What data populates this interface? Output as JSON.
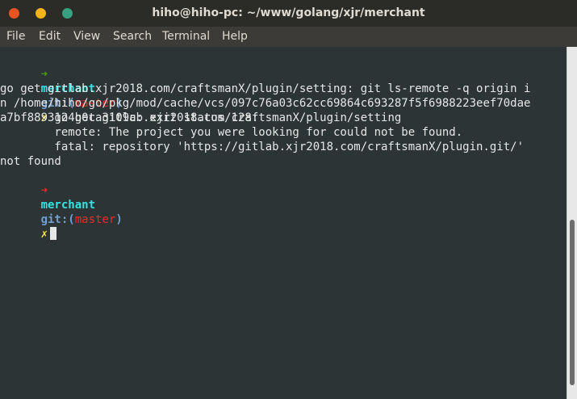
{
  "window": {
    "title": "hiho@hiho-pc: ~/www/golang/xjr/merchant"
  },
  "controls": {
    "close_color": "#e95420",
    "minimize_color": "#f5b31a",
    "maximize_color": "#37a07e"
  },
  "menu": {
    "items": [
      {
        "label": "File"
      },
      {
        "label": "Edit"
      },
      {
        "label": "View"
      },
      {
        "label": "Search"
      },
      {
        "label": "Terminal"
      },
      {
        "label": "Help"
      }
    ]
  },
  "prompt": {
    "arrow": "➜",
    "dir": "merchant",
    "git": "git:(",
    "branch": "master",
    "git_close": ")",
    "dirty": "✗"
  },
  "command": {
    "text": " go get gitlab.xjr2018.com/craftsmanX/plugin/setting"
  },
  "output": {
    "lines": [
      "",
      "go get gitlab.xjr2018.com/craftsmanX/plugin/setting: git ls-remote -q origin i",
      "n /home/hiho/go/pkg/mod/cache/vcs/097c76a03c62cc69864c693287f5f6988223eef70dae",
      "a7bf8893124b0ca3109c: exit status 128:",
      "        remote: The project you were looking for could not be found.",
      "        fatal: repository 'https://gitlab.xjr2018.com/craftsmanX/plugin.git/'",
      "not found"
    ]
  }
}
